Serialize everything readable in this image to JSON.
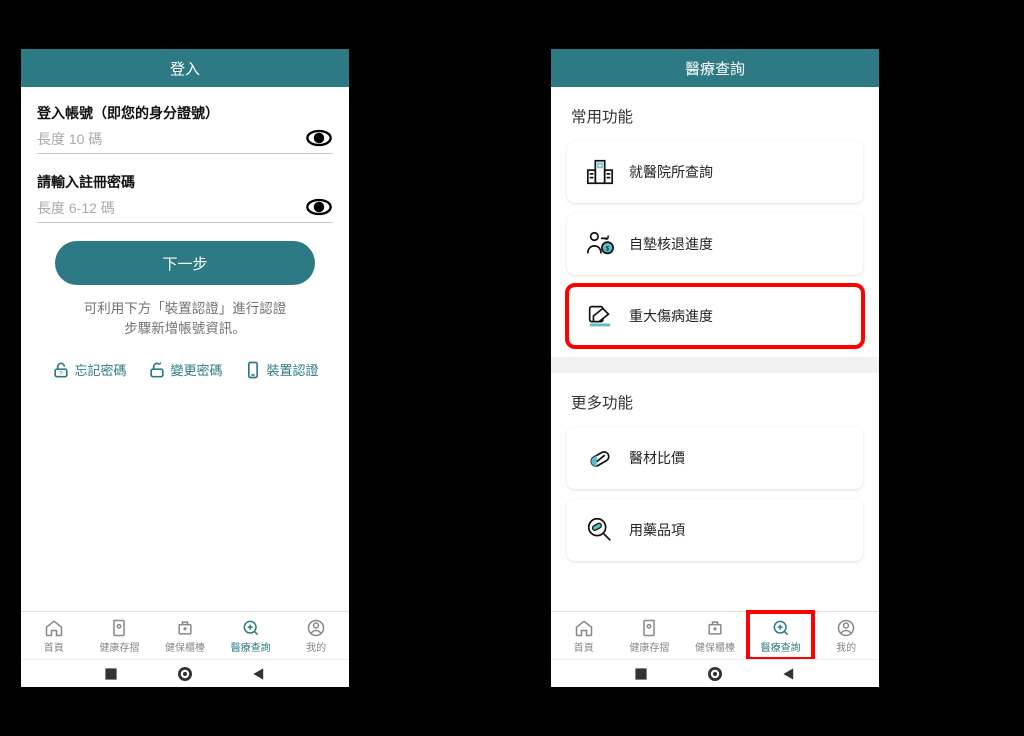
{
  "login": {
    "title": "登入",
    "account_label": "登入帳號（即您的身分證號）",
    "account_placeholder": "長度 10 碼",
    "password_label": "請輸入註冊密碼",
    "password_placeholder": "長度 6-12 碼",
    "next_button": "下一步",
    "hint_line1": "可利用下方「裝置認證」進行認證",
    "hint_line2": "步驟新增帳號資訊。",
    "links": {
      "forgot": "忘記密碼",
      "change": "變更密碼",
      "device": "裝置認證"
    }
  },
  "medical": {
    "title": "醫療查詢",
    "section_frequent": "常用功能",
    "section_more": "更多功能",
    "items": {
      "hospital": "就醫院所查詢",
      "reimburse": "自墊核退進度",
      "major_illness": "重大傷病進度",
      "material_price": "醫材比價",
      "medication": "用藥品項"
    }
  },
  "tabs": {
    "home": "首頁",
    "healthbook": "健康存摺",
    "counter": "健保櫃檯",
    "medical": "醫療查詢",
    "mine": "我的"
  }
}
